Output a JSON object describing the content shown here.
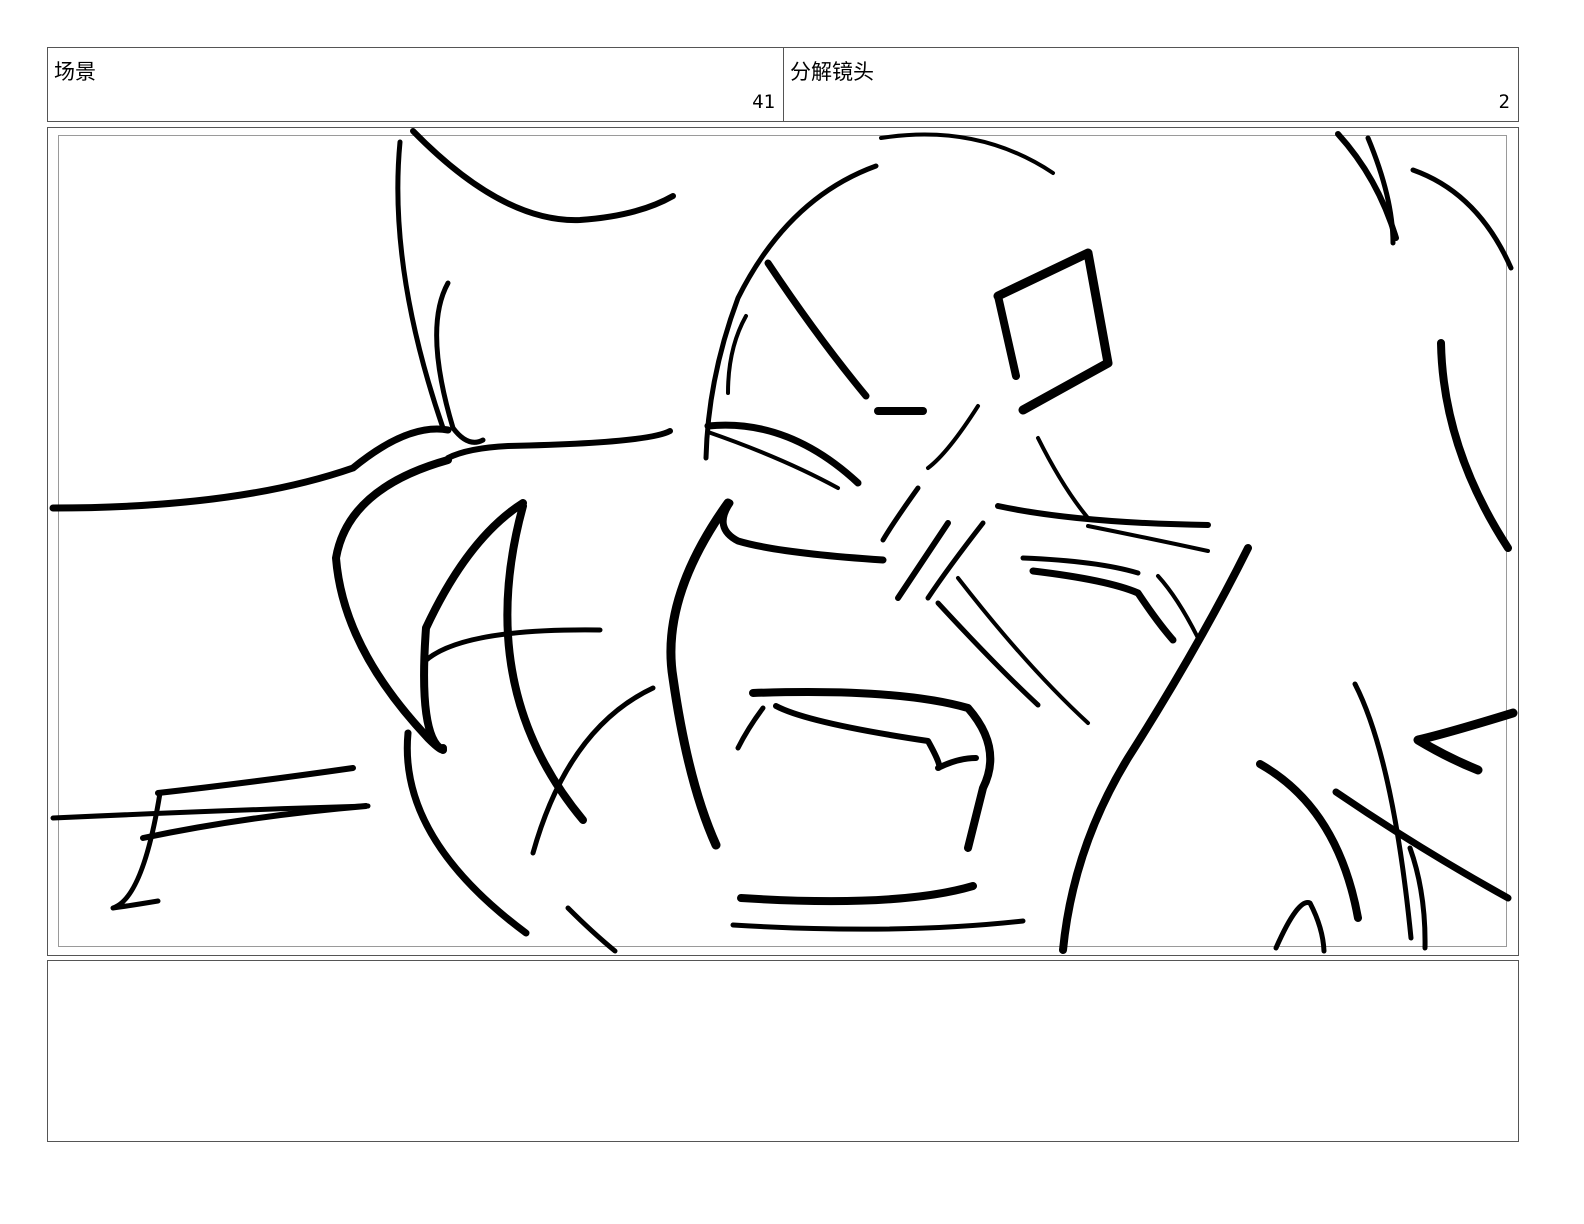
{
  "header": {
    "scene_label": "场景",
    "scene_number": "41",
    "shot_label": "分解镜头",
    "shot_number": "2"
  },
  "panel": {
    "sketch_icon": "storyboard-sketch-face-icon"
  },
  "notes": {
    "text": ""
  }
}
